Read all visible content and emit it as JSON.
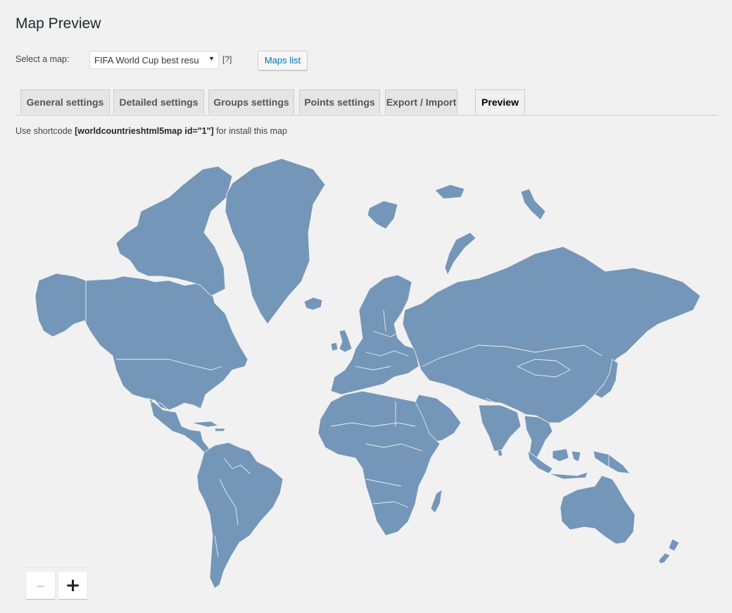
{
  "page": {
    "title": "Map Preview"
  },
  "map_selector": {
    "label": "Select a map:",
    "selected": "FIFA World Cup best resu",
    "arrow_glyph": "▼",
    "help": "[?]",
    "maps_list_button": "Maps list"
  },
  "tabs": [
    {
      "label": "General settings",
      "active": false
    },
    {
      "label": "Detailed settings",
      "active": false
    },
    {
      "label": "Groups settings",
      "active": false
    },
    {
      "label": "Points settings",
      "active": false
    },
    {
      "label": "Export / Import",
      "active": false
    },
    {
      "label": "Preview",
      "active": true
    }
  ],
  "shortcode": {
    "prefix": "Use shortcode ",
    "code": "[worldcountrieshtml5map id=\"1\"]",
    "suffix": " for install this map"
  },
  "map": {
    "land_color": "#7496b8",
    "border_color": "#e8eef4",
    "background_color": "#f1f1f1",
    "regions": [
      "north-america",
      "greenland",
      "canadian-arctic",
      "central-america",
      "caribbean",
      "south-america",
      "iceland",
      "europe",
      "africa",
      "madagascar",
      "eurasia",
      "arabian-peninsula",
      "india",
      "southeast-asia",
      "japan",
      "indonesia",
      "new-guinea",
      "australia",
      "new-zealand",
      "svalbard",
      "novaya-zemlya",
      "sri-lanka",
      "uk-ireland"
    ]
  },
  "zoom_controls": {
    "zoom_out_glyph": "–",
    "zoom_in_glyph": "+"
  }
}
